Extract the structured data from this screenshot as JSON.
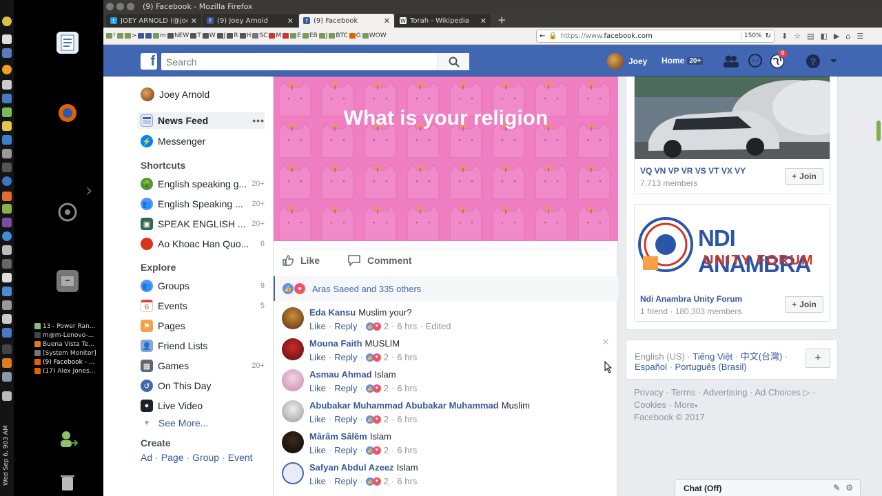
{
  "os": {
    "window_list": [
      {
        "label": "13 - Power Ran..."
      },
      {
        "label": "m@m-Lenovo-..."
      },
      {
        "label": "Buena Vista Te..."
      },
      {
        "label": "[System Monitor]"
      },
      {
        "label": "(9) Facebook - ..."
      },
      {
        "label": "(17) Alex Jones..."
      }
    ],
    "clock": "Wed Sep 6, 903 AM"
  },
  "browser": {
    "title": "(9) Facebook - Mozilla Firefox",
    "tabs": [
      {
        "label": "JOEY ARNOLD (@joey"
      },
      {
        "label": "(9) Joey Arnold"
      },
      {
        "label": "(9) Facebook"
      },
      {
        "label": "Torah - Wikipedia"
      }
    ],
    "bookmarks": [
      "!",
      ">",
      "m",
      "NEW",
      "T",
      "W",
      "J",
      "R",
      "H",
      "SC",
      "M",
      "E",
      "EB",
      "J",
      "BTC",
      "G",
      "WOW"
    ],
    "url_prefix": "https://www.",
    "url_domain": "facebook.com",
    "zoom": "150%"
  },
  "fb": {
    "search_placeholder": "Search",
    "profile_name": "Joey",
    "home_label": "Home",
    "home_count": "20+",
    "notif_count": "9"
  },
  "left": {
    "profile": "Joey Arnold",
    "news_feed": "News Feed",
    "messenger": "Messenger",
    "shortcuts_title": "Shortcuts",
    "shortcuts": [
      {
        "label": "English speaking g...",
        "count": "20+"
      },
      {
        "label": "English Speaking ...",
        "count": "20+"
      },
      {
        "label": "SPEAK ENGLISH ...",
        "count": "20+"
      },
      {
        "label": "Ao Khoac Han Quo...",
        "count": "6"
      }
    ],
    "explore_title": "Explore",
    "explore": [
      {
        "label": "Groups",
        "count": "9"
      },
      {
        "label": "Events",
        "count": "5"
      },
      {
        "label": "Pages",
        "count": ""
      },
      {
        "label": "Friend Lists",
        "count": ""
      },
      {
        "label": "Games",
        "count": "20+"
      },
      {
        "label": "On This Day",
        "count": ""
      },
      {
        "label": "Live Video",
        "count": ""
      }
    ],
    "see_more": "See More...",
    "create_title": "Create",
    "create_links": [
      "Ad",
      "Page",
      "Group",
      "Event"
    ],
    "events_icon_num": "6"
  },
  "post": {
    "image_text": "What is your religion",
    "like_label": "Like",
    "comment_label": "Comment",
    "reactions_text": "Aras Saeed and 335 others",
    "comments": [
      {
        "name": "Eda Kansu",
        "text": "Muslim your?",
        "reacts": "2",
        "time": "6 hrs",
        "edited": "Edited"
      },
      {
        "name": "Mouna Faith",
        "text": "MUSLIM",
        "reacts": "2",
        "time": "6 hrs",
        "edited": ""
      },
      {
        "name": "Asmau Ahmad",
        "text": "Islam",
        "reacts": "2",
        "time": "6 hrs",
        "edited": ""
      },
      {
        "name": "Abubakar Muhammad Abubakar Muhammad",
        "text": "Muslim",
        "reacts": "2",
        "time": "6 hrs",
        "edited": ""
      },
      {
        "name": "Mârâm Sâlĕm",
        "text": "Islam",
        "reacts": "2",
        "time": "6 hrs",
        "edited": ""
      },
      {
        "name": "Safyan Abdul Azeez",
        "text": "Islam",
        "reacts": "2",
        "time": "6 hrs",
        "edited": ""
      }
    ],
    "comment_like": "Like",
    "comment_reply": "Reply"
  },
  "right": {
    "group1": {
      "name": "VQ VN VP VR VS VT VX VY",
      "sub": "7,713 members"
    },
    "group2": {
      "name": "Ndi Anambra Unity Forum",
      "sub": "1 friend · 180,303 members",
      "img_line1": "NDI ANAMBRA",
      "img_line2": "UNITY FORUM"
    },
    "join_label": "Join",
    "lang_current": "English (US)",
    "lang_links": [
      "Tiếng Việt",
      "中文(台灣)",
      "Español",
      "Português (Brasil)"
    ],
    "footer1": [
      "Privacy",
      "Terms",
      "Advertising",
      "Ad Choices"
    ],
    "footer2": [
      "Cookies",
      "More"
    ],
    "copyright": "Facebook © 2017"
  },
  "chat": {
    "label": "Chat (Off)"
  }
}
